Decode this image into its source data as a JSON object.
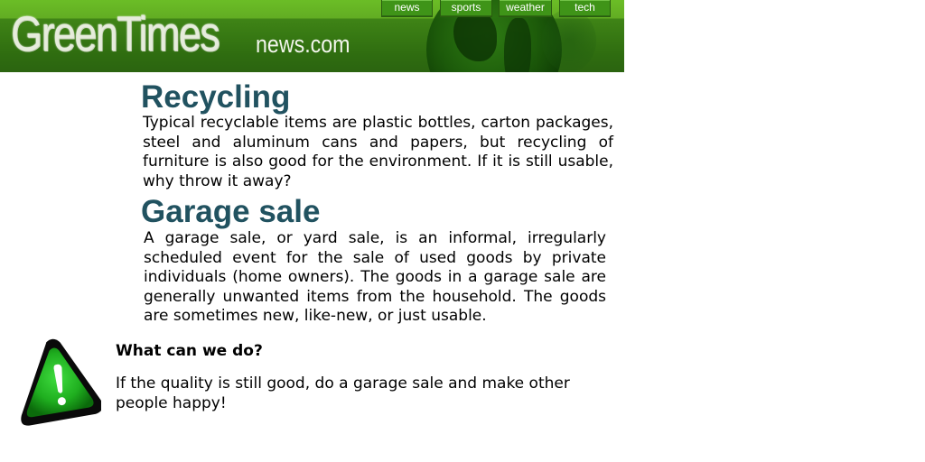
{
  "header": {
    "logo_main": "GreenTimes",
    "logo_sub": "news.com",
    "nav": [
      {
        "label": "news"
      },
      {
        "label": "sports"
      },
      {
        "label": "weather"
      },
      {
        "label": "tech"
      }
    ]
  },
  "sections": [
    {
      "title": "Recycling",
      "text": "Typical recyclable items are plastic bottles, carton packages, steel and aluminum cans and papers, but recycling of furniture is also good for the environment. If it is still usable, why throw it away?"
    },
    {
      "title": "Garage sale",
      "text": "A garage sale, or yard sale, is an informal, irregularly scheduled event for the sale of used goods by private individuals (home owners). The goods in a garage sale are generally unwanted items from the household. The goods are sometimes new, like-new, or just usable."
    }
  ],
  "callout": {
    "icon": "warning-exclamation-icon",
    "title": "What can we do?",
    "text": "If the quality is still good, do a garage sale and make other people happy!"
  },
  "colors": {
    "header_green": "#3f8416",
    "heading_teal": "#215260",
    "icon_green": "#1fae1f"
  }
}
